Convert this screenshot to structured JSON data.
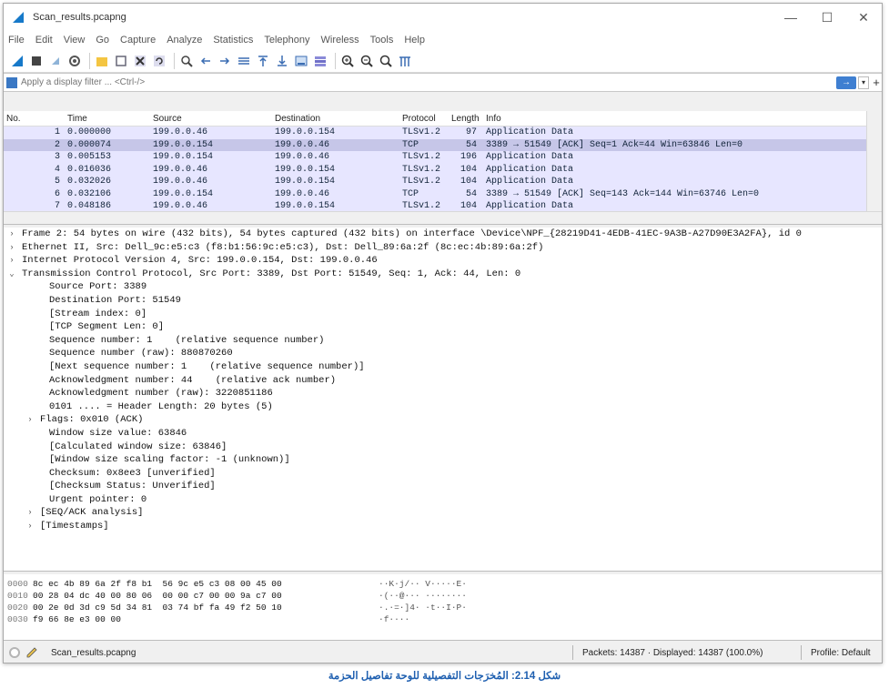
{
  "window": {
    "title": "Scan_results.pcapng",
    "controls": {
      "minimize": "—",
      "maximize": "☐",
      "close": "✕"
    }
  },
  "menu": [
    "File",
    "Edit",
    "View",
    "Go",
    "Capture",
    "Analyze",
    "Statistics",
    "Telephony",
    "Wireless",
    "Tools",
    "Help"
  ],
  "filter": {
    "placeholder": "Apply a display filter ... <Ctrl-/>",
    "apply_label": "→",
    "dropdown_label": "▾",
    "plus_label": "+"
  },
  "packet_list": {
    "columns": [
      "No.",
      "Time",
      "Source",
      "Destination",
      "Protocol",
      "Length",
      "Info"
    ],
    "rows": [
      {
        "no": "1",
        "time": "0.000000",
        "src": "199.0.0.46",
        "dst": "199.0.0.154",
        "proto": "TLSv1.2",
        "len": "97",
        "info": "Application Data",
        "kind": "tls"
      },
      {
        "no": "2",
        "time": "0.000074",
        "src": "199.0.0.154",
        "dst": "199.0.0.46",
        "proto": "TCP",
        "len": "54",
        "info": "3389 → 51549 [ACK] Seq=1 Ack=44 Win=63846 Len=0",
        "kind": "selected"
      },
      {
        "no": "3",
        "time": "0.005153",
        "src": "199.0.0.154",
        "dst": "199.0.0.46",
        "proto": "TLSv1.2",
        "len": "196",
        "info": "Application Data",
        "kind": "tls"
      },
      {
        "no": "4",
        "time": "0.016036",
        "src": "199.0.0.46",
        "dst": "199.0.0.154",
        "proto": "TLSv1.2",
        "len": "104",
        "info": "Application Data",
        "kind": "tls"
      },
      {
        "no": "5",
        "time": "0.032026",
        "src": "199.0.0.46",
        "dst": "199.0.0.154",
        "proto": "TLSv1.2",
        "len": "104",
        "info": "Application Data",
        "kind": "tls"
      },
      {
        "no": "6",
        "time": "0.032106",
        "src": "199.0.0.154",
        "dst": "199.0.0.46",
        "proto": "TCP",
        "len": "54",
        "info": "3389 → 51549 [ACK] Seq=143 Ack=144 Win=63746 Len=0",
        "kind": "tcp"
      },
      {
        "no": "7",
        "time": "0.048186",
        "src": "199.0.0.46",
        "dst": "199.0.0.154",
        "proto": "TLSv1.2",
        "len": "104",
        "info": "Application Data",
        "kind": "tls"
      }
    ]
  },
  "details": [
    {
      "indent": 0,
      "arrow": "›",
      "text": "Frame 2: 54 bytes on wire (432 bits), 54 bytes captured (432 bits) on interface \\Device\\NPF_{28219D41-4EDB-41EC-9A3B-A27D90E3A2FA}, id 0"
    },
    {
      "indent": 0,
      "arrow": "›",
      "text": "Ethernet II, Src: Dell_9c:e5:c3 (f8:b1:56:9c:e5:c3), Dst: Dell_89:6a:2f (8c:ec:4b:89:6a:2f)"
    },
    {
      "indent": 0,
      "arrow": "›",
      "text": "Internet Protocol Version 4, Src: 199.0.0.154, Dst: 199.0.0.46"
    },
    {
      "indent": 0,
      "arrow": "⌄",
      "text": "Transmission Control Protocol, Src Port: 3389, Dst Port: 51549, Seq: 1, Ack: 44, Len: 0"
    },
    {
      "indent": 1,
      "arrow": "",
      "text": "Source Port: 3389"
    },
    {
      "indent": 1,
      "arrow": "",
      "text": "Destination Port: 51549"
    },
    {
      "indent": 1,
      "arrow": "",
      "text": "[Stream index: 0]"
    },
    {
      "indent": 1,
      "arrow": "",
      "text": "[TCP Segment Len: 0]"
    },
    {
      "indent": 1,
      "arrow": "",
      "text": "Sequence number: 1    (relative sequence number)"
    },
    {
      "indent": 1,
      "arrow": "",
      "text": "Sequence number (raw): 880870260"
    },
    {
      "indent": 1,
      "arrow": "",
      "text": "[Next sequence number: 1    (relative sequence number)]"
    },
    {
      "indent": 1,
      "arrow": "",
      "text": "Acknowledgment number: 44    (relative ack number)"
    },
    {
      "indent": 1,
      "arrow": "",
      "text": "Acknowledgment number (raw): 3220851186"
    },
    {
      "indent": 1,
      "arrow": "",
      "text": "0101 .... = Header Length: 20 bytes (5)"
    },
    {
      "indent": 1,
      "arrow": "›",
      "text": "Flags: 0x010 (ACK)"
    },
    {
      "indent": 1,
      "arrow": "",
      "text": "Window size value: 63846"
    },
    {
      "indent": 1,
      "arrow": "",
      "text": "[Calculated window size: 63846]"
    },
    {
      "indent": 1,
      "arrow": "",
      "text": "[Window size scaling factor: -1 (unknown)]"
    },
    {
      "indent": 1,
      "arrow": "",
      "text": "Checksum: 0x8ee3 [unverified]"
    },
    {
      "indent": 1,
      "arrow": "",
      "text": "[Checksum Status: Unverified]"
    },
    {
      "indent": 1,
      "arrow": "",
      "text": "Urgent pointer: 0"
    },
    {
      "indent": 1,
      "arrow": "›",
      "text": "[SEQ/ACK analysis]"
    },
    {
      "indent": 1,
      "arrow": "›",
      "text": "[Timestamps]"
    }
  ],
  "bytes": [
    {
      "offset": "0000",
      "hex": "8c ec 4b 89 6a 2f f8 b1  56 9c e5 c3 08 00 45 00",
      "ascii": "··K·j/·· V·····E·"
    },
    {
      "offset": "0010",
      "hex": "00 28 04 dc 40 00 80 06  00 00 c7 00 00 9a c7 00",
      "ascii": "·(··@··· ········"
    },
    {
      "offset": "0020",
      "hex": "00 2e 0d 3d c9 5d 34 81  03 74 bf fa 49 f2 50 10",
      "ascii": "·.·=·]4· ·t··I·P·"
    },
    {
      "offset": "0030",
      "hex": "f9 66 8e e3 00 00",
      "ascii": "·f····"
    }
  ],
  "status": {
    "file": "Scan_results.pcapng",
    "packets": "Packets: 14387 · Displayed: 14387 (100.0%)",
    "profile": "Profile: Default"
  },
  "caption": "شكل 2.14: المُخرَجات التفصيلية للوحة تفاصيل الحزمة",
  "colors": {
    "tls_row": "#e7e6ff",
    "selected_row": "#c6c6e8",
    "caption": "#1e5fb0"
  }
}
